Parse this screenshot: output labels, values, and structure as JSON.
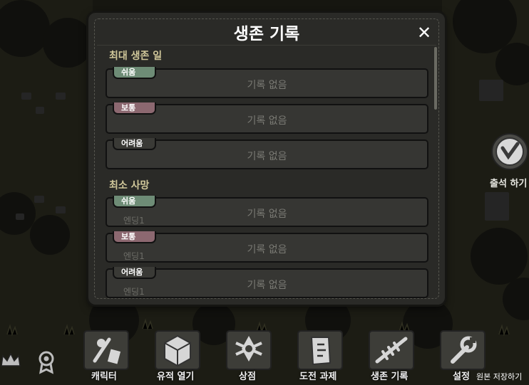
{
  "modal": {
    "title": "생존 기록",
    "close_glyph": "✕",
    "sections": [
      {
        "title": "최대 생존 일",
        "rows": [
          {
            "tag": "쉬움",
            "value": "기록 없음",
            "sub": ""
          },
          {
            "tag": "보통",
            "value": "기록 없음",
            "sub": ""
          },
          {
            "tag": "어려움",
            "value": "기록 없음",
            "sub": ""
          }
        ]
      },
      {
        "title": "최소 사망",
        "rows": [
          {
            "tag": "쉬움",
            "value": "기록 없음",
            "sub": "엔딩1"
          },
          {
            "tag": "보통",
            "value": "기록 없음",
            "sub": "엔딩1"
          },
          {
            "tag": "어려움",
            "value": "기록 없음",
            "sub": "엔딩1"
          }
        ]
      }
    ]
  },
  "side": {
    "attendance_label": "출석 하기"
  },
  "bottom_nav": {
    "items": [
      {
        "label": "캐릭터",
        "icon": "character-icon"
      },
      {
        "label": "유적 열기",
        "icon": "ruins-icon"
      },
      {
        "label": "상점",
        "icon": "shop-icon"
      },
      {
        "label": "도전 과제",
        "icon": "challenge-icon"
      },
      {
        "label": "생존 기록",
        "icon": "survival-record-icon"
      },
      {
        "label": "설정",
        "icon": "settings-icon"
      }
    ],
    "save_original_label": "원본 저장하기"
  },
  "colors": {
    "easy_tag": "#6e8c76",
    "normal_tag": "#8c6870",
    "hard_tag": "#3a3a36",
    "section_title": "#d0c79a"
  }
}
